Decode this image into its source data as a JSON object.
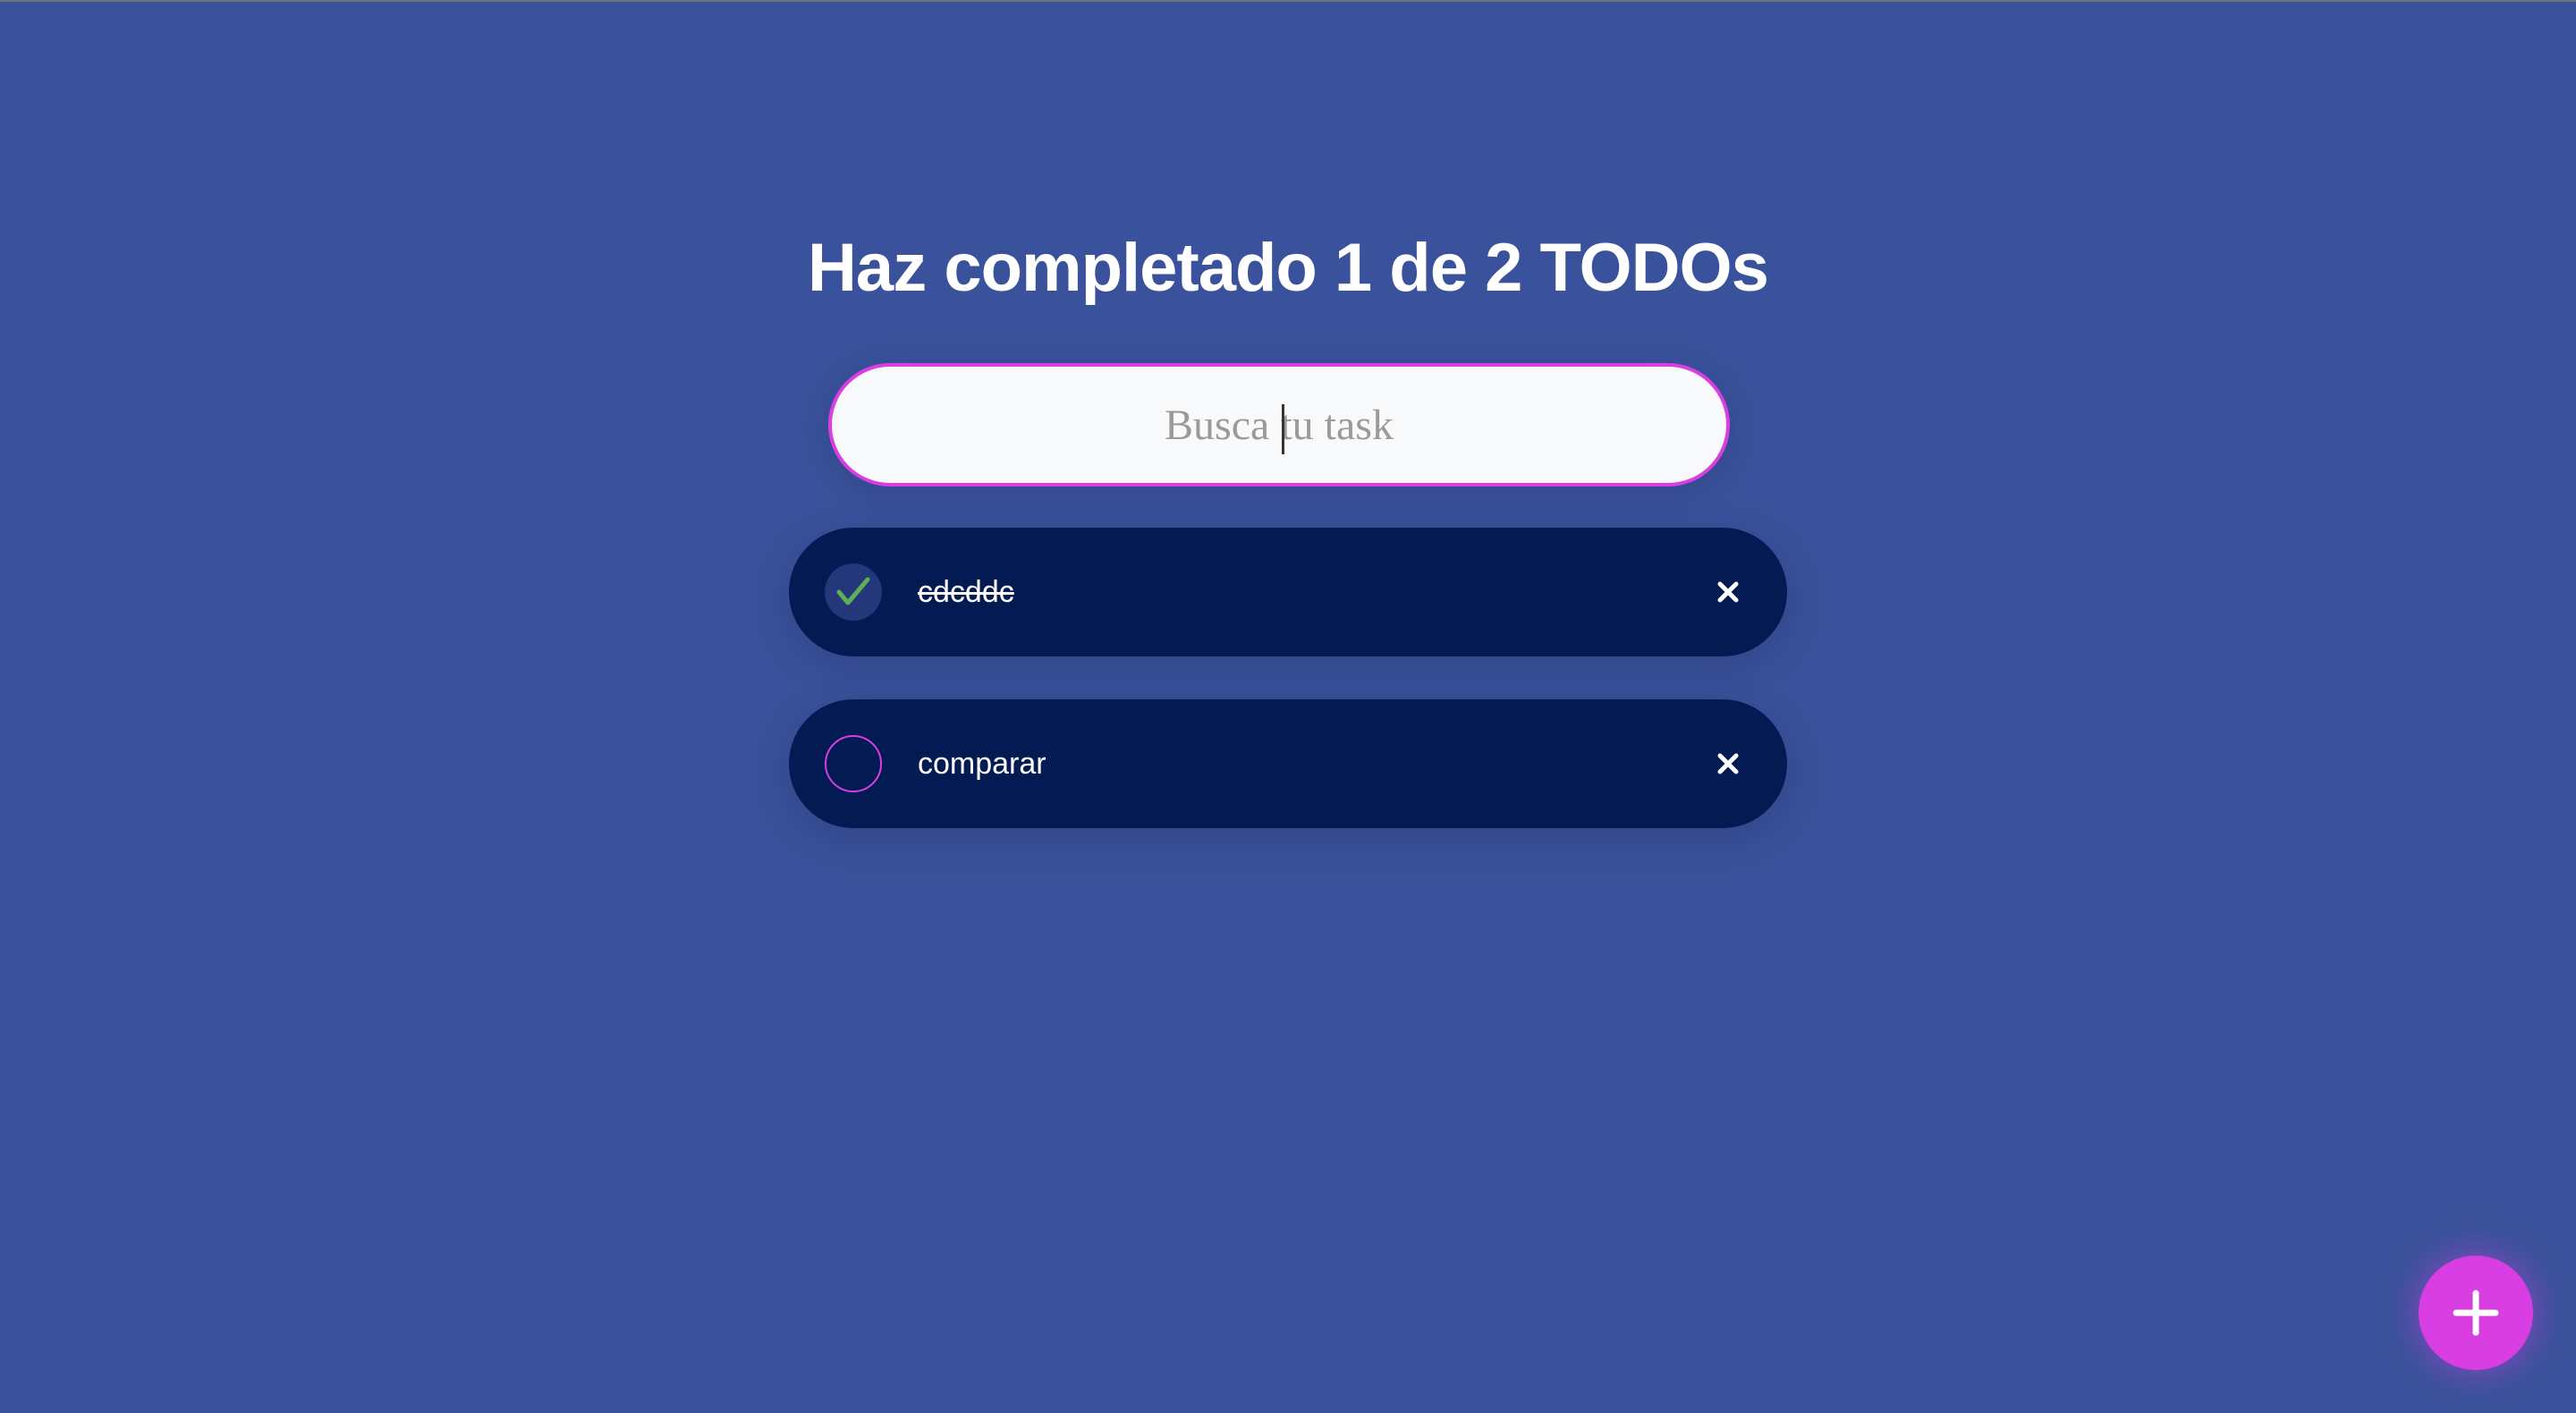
{
  "header": {
    "title": "Haz completado 1 de 2 TODOs"
  },
  "search": {
    "placeholder": "Busca tu task",
    "value": ""
  },
  "todos": [
    {
      "text": "cdcddc",
      "completed": true,
      "delete_icon": "close-icon"
    },
    {
      "text": "comparar",
      "completed": false,
      "delete_icon": "close-icon"
    }
  ],
  "fab": {
    "icon": "plus-icon"
  },
  "colors": {
    "background": "#3a529b",
    "accent": "#d93ee3",
    "item_background": "#031a53",
    "check_green": "#5fae5a"
  }
}
